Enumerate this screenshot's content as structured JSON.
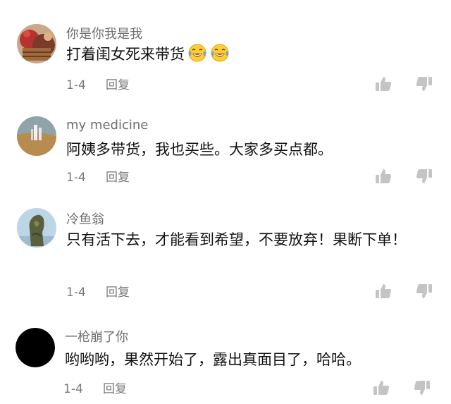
{
  "comments": [
    {
      "username": "你是你我是我",
      "text": "打着闺女死来带货",
      "emoji_icons": [
        "tears-of-joy-emoji-icon",
        "tears-of-joy-emoji-icon"
      ],
      "date": "1-4",
      "reply_label": "回复"
    },
    {
      "username": "my medicine",
      "text": "阿姨多带货，我也买些。大家多买点都。",
      "date": "1-4",
      "reply_label": "回复"
    },
    {
      "username": "冷鱼翁",
      "text": "只有活下去，才能看到希望，不要放弃！果断下单！",
      "date": "1-4",
      "reply_label": "回复"
    },
    {
      "username": "一枪崩了你",
      "text": "哟哟哟，果然开始了，露出真面目了，哈哈。",
      "date": "1-4",
      "reply_label": "回复"
    }
  ],
  "icons": {
    "like": "thumbs-up-icon",
    "dislike": "thumbs-down-icon"
  },
  "colors": {
    "text": "#111111",
    "muted": "#6e6e6e",
    "icon": "#c4c4c4"
  }
}
